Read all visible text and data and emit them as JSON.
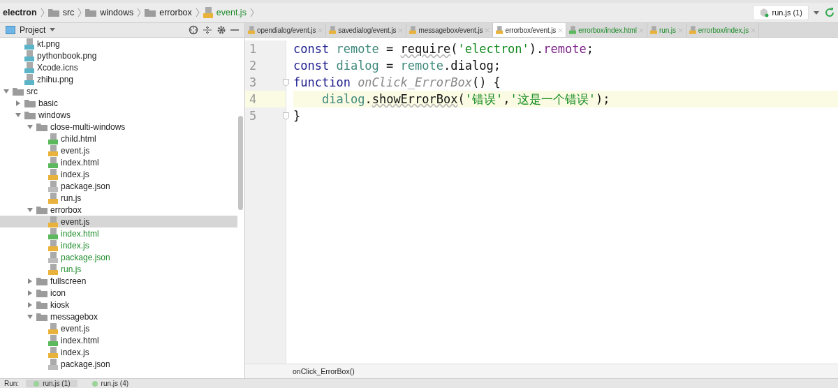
{
  "breadcrumbs": [
    {
      "label": "electron",
      "kind": "project"
    },
    {
      "label": "src",
      "kind": "folder"
    },
    {
      "label": "windows",
      "kind": "folder"
    },
    {
      "label": "errorbox",
      "kind": "folder"
    },
    {
      "label": "event.js",
      "kind": "js"
    }
  ],
  "run_config": {
    "label": "run.js (1)"
  },
  "project_panel": {
    "title": "Project"
  },
  "tree": [
    {
      "children": [
        {
          "name": "kt.png",
          "kind": "image",
          "selected": false,
          "vcs_new": false
        },
        {
          "name": "pythonbook.png",
          "kind": "image",
          "selected": false,
          "vcs_new": false
        },
        {
          "name": "Xcode.icns",
          "kind": "image",
          "selected": false,
          "vcs_new": false
        },
        {
          "name": "zhihu.png",
          "kind": "image",
          "selected": false,
          "vcs_new": false
        }
      ]
    },
    {
      "name": "src",
      "kind": "folder",
      "expanded": true,
      "selected": false,
      "vcs_new": false,
      "children": [
        {
          "name": "basic",
          "kind": "folder",
          "expanded": false,
          "selected": false,
          "vcs_new": false
        },
        {
          "name": "windows",
          "kind": "folder",
          "expanded": true,
          "selected": false,
          "vcs_new": false,
          "children": [
            {
              "name": "close-multi-windows",
              "kind": "folder",
              "expanded": true,
              "selected": false,
              "vcs_new": false,
              "children": [
                {
                  "name": "child.html",
                  "kind": "html",
                  "selected": false,
                  "vcs_new": false
                },
                {
                  "name": "event.js",
                  "kind": "js",
                  "selected": false,
                  "vcs_new": false
                },
                {
                  "name": "index.html",
                  "kind": "html",
                  "selected": false,
                  "vcs_new": false
                },
                {
                  "name": "index.js",
                  "kind": "js",
                  "selected": false,
                  "vcs_new": false
                },
                {
                  "name": "package.json",
                  "kind": "json",
                  "selected": false,
                  "vcs_new": false
                },
                {
                  "name": "run.js",
                  "kind": "js",
                  "selected": false,
                  "vcs_new": false
                }
              ]
            },
            {
              "name": "errorbox",
              "kind": "folder",
              "expanded": true,
              "selected": false,
              "vcs_new": false,
              "children": [
                {
                  "name": "event.js",
                  "kind": "js",
                  "selected": true,
                  "vcs_new": false
                },
                {
                  "name": "index.html",
                  "kind": "html",
                  "selected": false,
                  "vcs_new": true
                },
                {
                  "name": "index.js",
                  "kind": "js",
                  "selected": false,
                  "vcs_new": true
                },
                {
                  "name": "package.json",
                  "kind": "json",
                  "selected": false,
                  "vcs_new": true
                },
                {
                  "name": "run.js",
                  "kind": "js",
                  "selected": false,
                  "vcs_new": true
                }
              ]
            },
            {
              "name": "fullscreen",
              "kind": "folder",
              "expanded": false,
              "selected": false,
              "vcs_new": false
            },
            {
              "name": "icon",
              "kind": "folder",
              "expanded": false,
              "selected": false,
              "vcs_new": false
            },
            {
              "name": "kiosk",
              "kind": "folder",
              "expanded": false,
              "selected": false,
              "vcs_new": false
            },
            {
              "name": "messagebox",
              "kind": "folder",
              "expanded": true,
              "selected": false,
              "vcs_new": false,
              "children": [
                {
                  "name": "event.js",
                  "kind": "js",
                  "selected": false,
                  "vcs_new": false
                },
                {
                  "name": "index.html",
                  "kind": "html",
                  "selected": false,
                  "vcs_new": false
                },
                {
                  "name": "index.js",
                  "kind": "js",
                  "selected": false,
                  "vcs_new": false
                },
                {
                  "name": "package.json",
                  "kind": "json",
                  "selected": false,
                  "vcs_new": false
                }
              ]
            }
          ]
        }
      ]
    }
  ],
  "tabs": [
    {
      "label": "opendialog/event.js",
      "kind": "js",
      "selected": false,
      "vcs_new": false
    },
    {
      "label": "savedialog/event.js",
      "kind": "js",
      "selected": false,
      "vcs_new": false
    },
    {
      "label": "messagebox/event.js",
      "kind": "js",
      "selected": false,
      "vcs_new": false
    },
    {
      "label": "errorbox/event.js",
      "kind": "js",
      "selected": true,
      "vcs_new": false
    },
    {
      "label": "errorbox/index.html",
      "kind": "html",
      "selected": false,
      "vcs_new": true
    },
    {
      "label": "run.js",
      "kind": "js",
      "selected": false,
      "vcs_new": true
    },
    {
      "label": "errorbox/index.js",
      "kind": "js",
      "selected": false,
      "vcs_new": true
    }
  ],
  "code_lines": [
    {
      "number": "1",
      "current": false,
      "fold": false,
      "tokens": [
        {
          "text": "const ",
          "kind": "keyword"
        },
        {
          "text": "remote",
          "kind": "variable"
        },
        {
          "text": " = ",
          "kind": "plain"
        },
        {
          "text": "require",
          "kind": "call"
        },
        {
          "text": "(",
          "kind": "plain"
        },
        {
          "text": "'electron'",
          "kind": "string"
        },
        {
          "text": ").",
          "kind": "plain"
        },
        {
          "text": "remote",
          "kind": "member"
        },
        {
          "text": ";",
          "kind": "plain"
        }
      ]
    },
    {
      "number": "2",
      "current": false,
      "fold": false,
      "tokens": [
        {
          "text": "const ",
          "kind": "keyword"
        },
        {
          "text": "dialog",
          "kind": "variable"
        },
        {
          "text": " = ",
          "kind": "plain"
        },
        {
          "text": "remote",
          "kind": "variable"
        },
        {
          "text": ".dialog;",
          "kind": "plain"
        }
      ]
    },
    {
      "number": "3",
      "current": false,
      "fold": true,
      "tokens": [
        {
          "text": "function ",
          "kind": "keyword"
        },
        {
          "text": "onClick_ErrorBox",
          "kind": "function"
        },
        {
          "text": "() {",
          "kind": "plain"
        }
      ],
      "children": [
        {
          "number": "4",
          "current": true,
          "fold": false,
          "tokens": [
            {
              "text": "dialog",
              "kind": "variable"
            },
            {
              "text": ".",
              "kind": "plain"
            },
            {
              "text": "showErrorBox",
              "kind": "call"
            },
            {
              "text": "(",
              "kind": "plain"
            },
            {
              "text": "'错误'",
              "kind": "string"
            },
            {
              "text": ",",
              "kind": "plain"
            },
            {
              "text": "'这是一个错误'",
              "kind": "string"
            },
            {
              "text": ");",
              "kind": "plain"
            }
          ]
        }
      ]
    },
    {
      "number": "5",
      "current": false,
      "fold": true,
      "tokens": [
        {
          "text": "}",
          "kind": "plain"
        }
      ]
    }
  ],
  "editor_breadcrumb": "onClick_ErrorBox()",
  "run_bar": {
    "label": "Run:",
    "tabs": [
      {
        "label": "run.js (1)",
        "selected": true
      },
      {
        "label": "run.js (4)",
        "selected": false
      }
    ]
  }
}
